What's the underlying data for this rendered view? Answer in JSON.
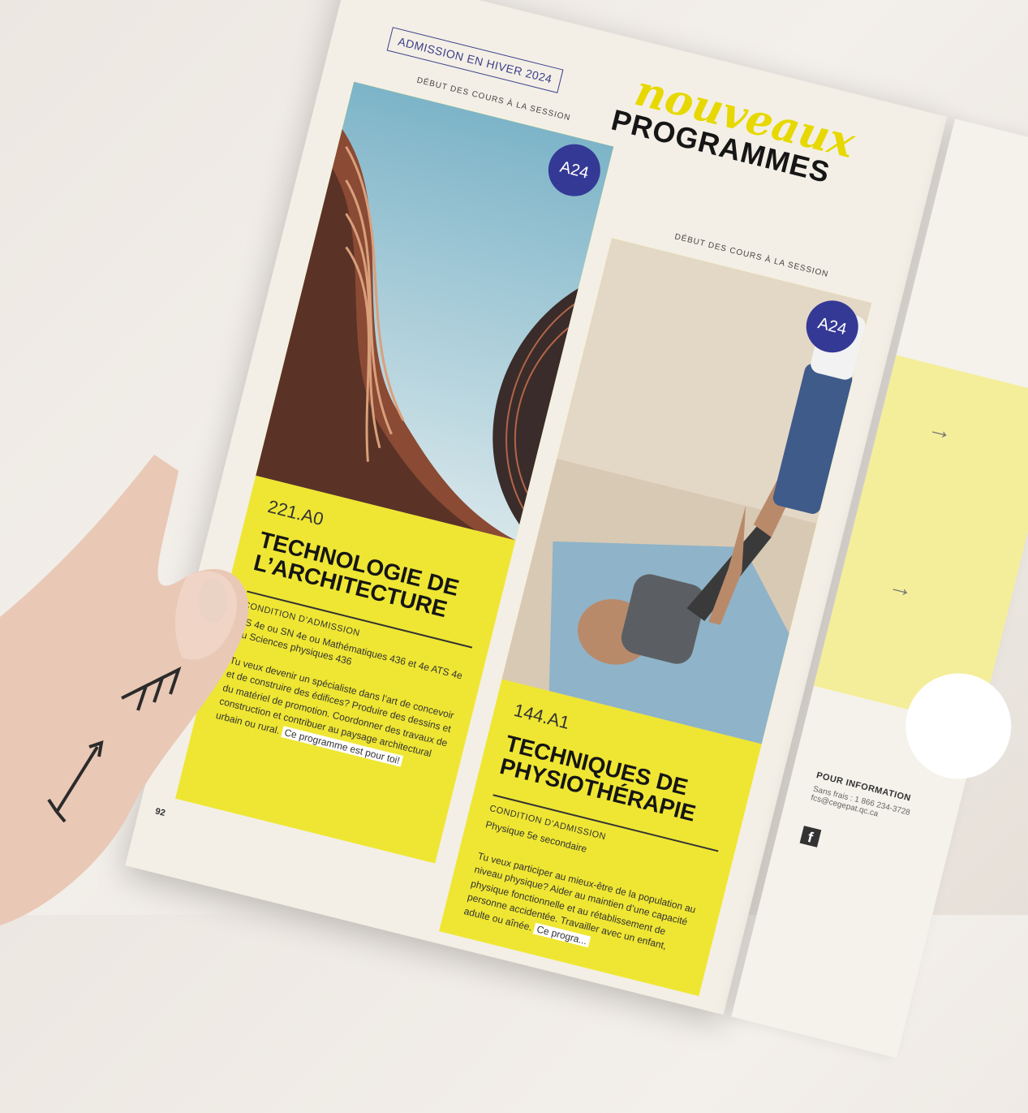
{
  "header": {
    "admission_badge": "ADMISSION EN HIVER 2024",
    "title_script": "nouveaux",
    "title_main": "PROGRAMMES"
  },
  "cards": [
    {
      "session_label": "DÉBUT DES COURS À LA SESSION",
      "session_badge": "A24",
      "code": "221.A0",
      "title": "TECHNOLOGIE DE L’ARCHITECTURE",
      "cond_label": "CONDITION D’ADMISSION",
      "cond_value": "TS 4e ou SN 4e ou Mathématiques 436 et 4e ATS 4e ou Sciences physiques 436",
      "body": "Tu veux devenir un spécialiste dans l’art de concevoir et de construire des édifices? Produire des dessins et du matériel de promotion. Coordonner des travaux de construction et contribuer au paysage architectural urbain ou rural.",
      "cta": "Ce programme est pour toi!"
    },
    {
      "session_label": "DÉBUT DES COURS À LA SESSION",
      "session_badge": "A24",
      "code": "144.A1",
      "title": "TECHNIQUES DE PHYSIOTHÉRAPIE",
      "cond_label": "CONDITION D’ADMISSION",
      "cond_value": "Physique 5e secondaire",
      "body": "Tu veux participer au mieux-être de la population au niveau physique? Aider au maintien d’une capacité physique fonctionnelle et au rétablissement de personne accidentée. Travailler avec un enfant, adulte ou aînée.",
      "cta": "Ce progra..."
    }
  ],
  "page_number": "92",
  "right_page": {
    "info_label": "POUR INFORMATION",
    "info_line1": "Sans frais : 1 866 234-3728",
    "info_line2": "fcs@cegepat.qc.ca",
    "facebook_glyph": "f",
    "arrow_glyph": "→"
  },
  "colors": {
    "card_yellow": "#efe633",
    "badge_blue": "#343995",
    "script_yellow": "#e6d800",
    "paper": "#f3efe6"
  }
}
